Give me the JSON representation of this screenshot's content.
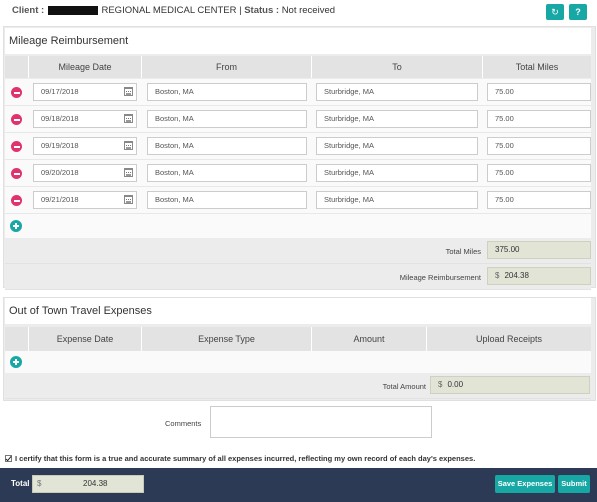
{
  "header": {
    "client_label": "Client :",
    "client_name": "REGIONAL MEDICAL CENTER",
    "separator": "|",
    "status_label": "Status :",
    "status_value": "Not received",
    "button1_icon": "circle-arrow-icon",
    "button2_icon": "help-icon"
  },
  "mileage": {
    "title": "Mileage Reimbursement",
    "columns": [
      "Mileage Date",
      "From",
      "To",
      "Total Miles"
    ],
    "rows": [
      {
        "date": "09/17/2018",
        "from": "Boston, MA",
        "to": "Sturbridge, MA",
        "miles": "75.00"
      },
      {
        "date": "09/18/2018",
        "from": "Boston, MA",
        "to": "Sturbridge, MA",
        "miles": "75.00"
      },
      {
        "date": "09/19/2018",
        "from": "Boston, MA",
        "to": "Sturbridge, MA",
        "miles": "75.00"
      },
      {
        "date": "09/20/2018",
        "from": "Boston, MA",
        "to": "Sturbridge, MA",
        "miles": "75.00"
      },
      {
        "date": "09/21/2018",
        "from": "Boston, MA",
        "to": "Sturbridge, MA",
        "miles": "75.00"
      }
    ],
    "total_miles_label": "Total Miles",
    "total_miles_value": "375.00",
    "reimbursement_label": "Mileage Reimbursement",
    "reimbursement_currency": "$",
    "reimbursement_value": "204.38"
  },
  "travel": {
    "title": "Out of Town Travel Expenses",
    "columns": [
      "Expense Date",
      "Expense Type",
      "Amount",
      "Upload Receipts"
    ],
    "total_amount_label": "Total Amount",
    "total_amount_currency": "$",
    "total_amount_value": "0.00",
    "comments_label": "Comments"
  },
  "certify_text": "I certify that this form is a true and accurate summary of all expenses incurred, reflecting my own record of each day's expenses.",
  "footer": {
    "total_label": "Total",
    "total_currency": "$",
    "total_value": "204.38",
    "save_label": "Save Expenses",
    "submit_label": "Submit"
  },
  "colors": {
    "accent": "#17a8a5",
    "remove": "#e0336b",
    "footer_bg": "#2c3a56",
    "readonly_bg": "#e2e4d6"
  }
}
